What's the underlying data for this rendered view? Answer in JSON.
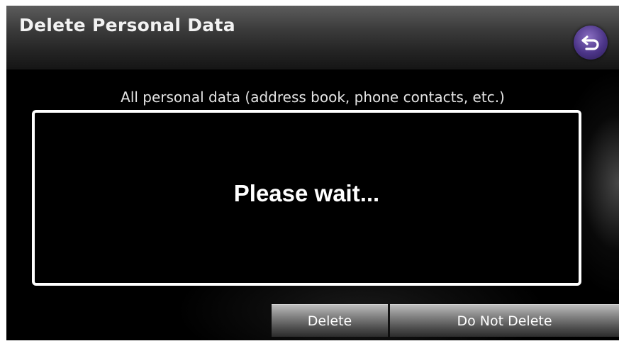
{
  "header": {
    "title": "Delete Personal Data",
    "back_icon": "return-arrow-icon"
  },
  "message": "All personal data (address book, phone contacts, etc.)",
  "dialog": {
    "text": "Please wait..."
  },
  "buttons": {
    "delete_label": "Delete",
    "do_not_delete_label": "Do Not Delete"
  },
  "colors": {
    "accent": "#4c3588",
    "dialog_border": "#ffffff",
    "background": "#000000"
  }
}
